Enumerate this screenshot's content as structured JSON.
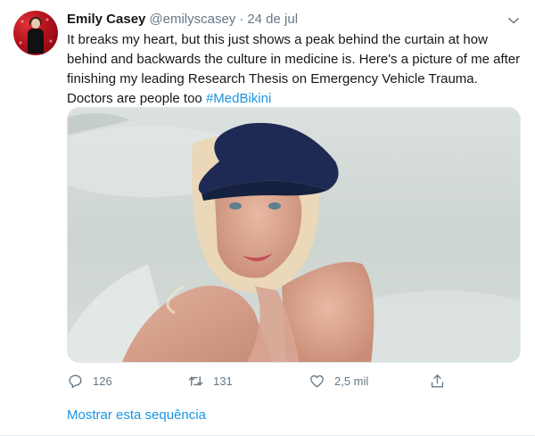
{
  "tweet": {
    "author": {
      "name": "Emily Casey",
      "handle": "@emilyscasey",
      "separator": "·",
      "date": "24 de jul"
    },
    "text": "It breaks my heart, but this just shows a peak behind the curtain at how behind and backwards the culture in medicine is. Here's a picture of me after finishing my leading Research Thesis on Emergency Vehicle Trauma. Doctors are people too ",
    "hashtag": "#MedBikini",
    "actions": {
      "reply": {
        "icon": "reply-icon",
        "count": "126"
      },
      "retweet": {
        "icon": "retweet-icon",
        "count": "131"
      },
      "like": {
        "icon": "heart-icon",
        "count": "2,5 mil"
      },
      "share": {
        "icon": "share-icon"
      }
    },
    "show_thread": "Mostrar esta sequência"
  },
  "colors": {
    "link": "#1b95e0",
    "muted": "#657786",
    "text": "#14171a",
    "border": "#e6ecf0"
  }
}
